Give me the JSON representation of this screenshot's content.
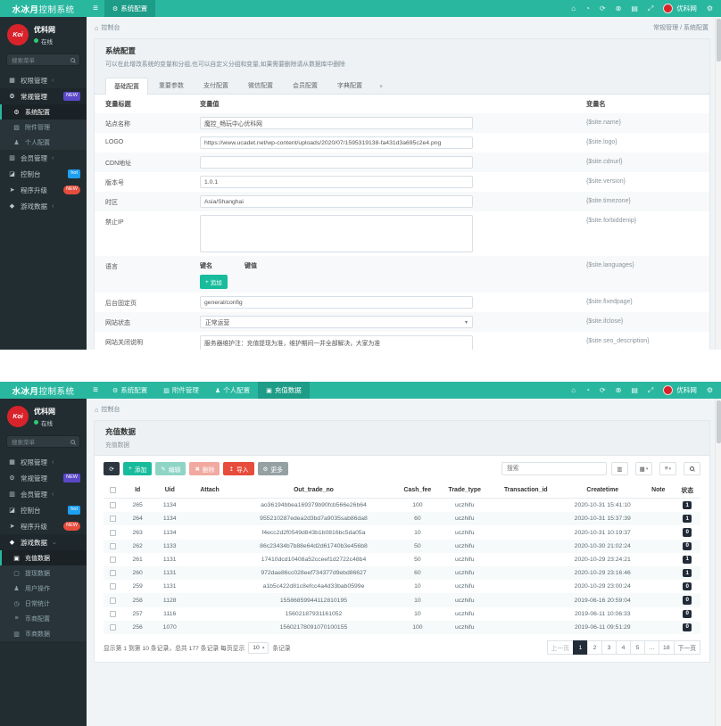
{
  "brand": {
    "bold": "水冰月",
    "rest": "控制系统"
  },
  "icons": {
    "burger": "≡",
    "gear": "⚙",
    "home": "⌂",
    "bell": "◔",
    "refresh": "⟳",
    "clear": "⊗",
    "layout": "▤",
    "fullscreen": "⤢",
    "add": "+",
    "edit": "✎",
    "delete": "✖",
    "import": "↥",
    "more": "⚙",
    "caret_down": "▾",
    "caret_up": "▴",
    "toggle_view": "▥",
    "columns": "▦",
    "export": "≡"
  },
  "user": {
    "logo_text": "Koi",
    "name": "优科网",
    "status": "在线"
  },
  "sidebar_search_placeholder": "搜索菜单",
  "top": {
    "navbar": {
      "tab": "系统配置"
    },
    "sidebar": [
      {
        "glyph": "▦",
        "label": "权限管理",
        "arrow": "‹",
        "cls": "item"
      },
      {
        "glyph": "⚙",
        "label": "常规管理",
        "badge": "NEW",
        "badgeClass": "b-new",
        "cls": "item open"
      },
      {
        "glyph": "⚙",
        "label": "系统配置",
        "cls": "sub active"
      },
      {
        "glyph": "▨",
        "label": "附件管理",
        "cls": "sub"
      },
      {
        "glyph": "♟",
        "label": "个人配置",
        "cls": "sub"
      },
      {
        "glyph": "▥",
        "label": "会员管理",
        "arrow": "‹",
        "cls": "item"
      },
      {
        "glyph": "◪",
        "label": "控制台",
        "badge": "hot",
        "badgeClass": "b-hot",
        "cls": "item"
      },
      {
        "glyph": "➤",
        "label": "程序升级",
        "badge": "NEW",
        "badgeClass": "b-red",
        "cls": "item"
      },
      {
        "glyph": "◆",
        "label": "游戏数据",
        "arrow": "‹",
        "cls": "item"
      }
    ],
    "breadcrumb": {
      "left": "控制台",
      "right": "常规管理 / 系统配置"
    },
    "panel": {
      "title": "系统配置",
      "desc": "可以在此增改系统的变量和分组,也可以自定义分组和变量,如果需要删除请从数据库中删除",
      "tabs": [
        {
          "label": "基础配置",
          "cls": "active"
        },
        {
          "label": "重要参数"
        },
        {
          "label": "支付配置"
        },
        {
          "label": "微信配置"
        },
        {
          "label": "会员配置"
        },
        {
          "label": "字典配置"
        },
        {
          "label": "+",
          "cls": "plus"
        }
      ]
    },
    "form": {
      "headers": [
        "变量标题",
        "变量值",
        "变量名"
      ],
      "kv_headers": [
        "键名",
        "键值"
      ],
      "append_label": "追加",
      "rows": [
        {
          "label": "站点名称",
          "value": "魔控_畅玩中心优科网",
          "var": "{$site.name}"
        },
        {
          "label": "LOGO",
          "value": "https://www.ucadet.net/wp-content/uploads/2020/07/1595319138-fa431d3a695c2e4.png",
          "var": "{$site.logo}"
        },
        {
          "label": "CDN地址",
          "value": "",
          "var": "{$site.cdnurl}"
        },
        {
          "label": "版本号",
          "value": "1.0.1",
          "var": "{$site.version}"
        },
        {
          "label": "时区",
          "value": "Asia/Shanghai",
          "var": "{$site.timezone}"
        },
        {
          "label": "禁止IP",
          "value": "",
          "var": "{$site.forbiddenip}"
        },
        {
          "label": "语言",
          "value": "",
          "var": "{$site.languages}"
        },
        {
          "label": "后台固定页",
          "value": "general/config",
          "var": "{$site.fixedpage}"
        },
        {
          "label": "网站状态",
          "value": "正常运营",
          "var": "{$site.ifclose}"
        },
        {
          "label": "网站关闭说明",
          "value": "服务器维护注：充值提现为准，维护期间一并全部解决，大家为准",
          "var": "{$site.seo_description}"
        }
      ]
    }
  },
  "bottom": {
    "navbar_tabs": [
      {
        "glyph": "⚙",
        "label": "系统配置",
        "cls": ""
      },
      {
        "glyph": "▨",
        "label": "附件管理",
        "cls": ""
      },
      {
        "glyph": "♟",
        "label": "个人配置",
        "cls": ""
      },
      {
        "glyph": "▣",
        "label": "充值数据",
        "cls": "active"
      }
    ],
    "sidebar": [
      {
        "glyph": "▦",
        "label": "权限管理",
        "arrow": "‹",
        "cls": "item"
      },
      {
        "glyph": "⚙",
        "label": "常规管理",
        "badge": "NEW",
        "badgeClass": "b-new",
        "cls": "item"
      },
      {
        "glyph": "▥",
        "label": "会员管理",
        "arrow": "‹",
        "cls": "item"
      },
      {
        "glyph": "◪",
        "label": "控制台",
        "badge": "hot",
        "badgeClass": "b-hot",
        "cls": "item"
      },
      {
        "glyph": "➤",
        "label": "程序升级",
        "badge": "NEW",
        "badgeClass": "b-red",
        "cls": "item"
      },
      {
        "glyph": "◆",
        "label": "游戏数据",
        "arrow": "⌄",
        "cls": "item open"
      },
      {
        "glyph": "▣",
        "label": "充值数据",
        "cls": "sub active"
      },
      {
        "glyph": "▢",
        "label": "提现数据",
        "cls": "sub"
      },
      {
        "glyph": "♟",
        "label": "用户操作",
        "cls": "sub"
      },
      {
        "glyph": "◷",
        "label": "日常统计",
        "cls": "sub"
      },
      {
        "glyph": "≡",
        "label": "币商配置",
        "cls": "sub"
      },
      {
        "glyph": "▥",
        "label": "币商数据",
        "cls": "sub"
      }
    ],
    "breadcrumb": {
      "left": "控制台"
    },
    "panel": {
      "title": "充值数据",
      "sub": "充值数据"
    },
    "toolbar": {
      "add": "添加",
      "edit": "编辑",
      "delete": "删除",
      "import": "导入",
      "more": "更多",
      "search_placeholder": "搜索"
    },
    "table": {
      "headers": [
        "Id",
        "Uid",
        "Attach",
        "Out_trade_no",
        "Cash_fee",
        "Trade_type",
        "Transaction_id",
        "Createtime",
        "Note",
        "状态"
      ],
      "rows": [
        {
          "id": "265",
          "uid": "1134",
          "attach": "",
          "out_trade_no": "ao36194bbea169379b90fcb566e26b64",
          "cash_fee": "100",
          "trade_type": "uczhifu",
          "transaction_id": "",
          "createtime": "2020-10-31 15:41:10",
          "note": "",
          "status": "1"
        },
        {
          "id": "264",
          "uid": "1134",
          "attach": "",
          "out_trade_no": "955210287edea2d3bd7a9035sab86da8",
          "cash_fee": "60",
          "trade_type": "uczhifu",
          "transaction_id": "",
          "createtime": "2020-10-31 15:37:39",
          "note": "",
          "status": "1"
        },
        {
          "id": "263",
          "uid": "1134",
          "attach": "",
          "out_trade_no": "f4ecc2d2f0549d843b1b0816bc5da05a",
          "cash_fee": "10",
          "trade_type": "uczhifu",
          "transaction_id": "",
          "createtime": "2020-10-31 10:19:37",
          "note": "",
          "status": "0"
        },
        {
          "id": "262",
          "uid": "1133",
          "attach": "",
          "out_trade_no": "86c23434b7b88e64d2d61740b3e456b8",
          "cash_fee": "50",
          "trade_type": "uczhifu",
          "transaction_id": "",
          "createtime": "2020-10-30 21:02:24",
          "note": "",
          "status": "0"
        },
        {
          "id": "261",
          "uid": "1131",
          "attach": "",
          "out_trade_no": "17410dcd10408a52cceef1d2722c48b4",
          "cash_fee": "50",
          "trade_type": "uczhifu",
          "transaction_id": "",
          "createtime": "2020-10-29 23:24:21",
          "note": "",
          "status": "1"
        },
        {
          "id": "260",
          "uid": "1131",
          "attach": "",
          "out_trade_no": "972dae86cc028eef734377d9ebd86627",
          "cash_fee": "60",
          "trade_type": "uczhifu",
          "transaction_id": "",
          "createtime": "2020-10-29 23:16:46",
          "note": "",
          "status": "1"
        },
        {
          "id": "259",
          "uid": "1131",
          "attach": "",
          "out_trade_no": "a1b5c422d81c8efcc4a4d33bab0599e",
          "cash_fee": "10",
          "trade_type": "uczhifu",
          "transaction_id": "",
          "createtime": "2020-10-29 23:00:24",
          "note": "",
          "status": "0"
        },
        {
          "id": "258",
          "uid": "1128",
          "attach": "",
          "out_trade_no": "15586859944112810195",
          "cash_fee": "10",
          "trade_type": "uczhifu",
          "transaction_id": "",
          "createtime": "2019-06-16 20:59:04",
          "note": "",
          "status": "0"
        },
        {
          "id": "257",
          "uid": "1116",
          "attach": "",
          "out_trade_no": "15602187931161052",
          "cash_fee": "10",
          "trade_type": "uczhifu",
          "transaction_id": "",
          "createtime": "2019-06-11 10:06:33",
          "note": "",
          "status": "0"
        },
        {
          "id": "256",
          "uid": "1070",
          "attach": "",
          "out_trade_no": "15602178091070100155",
          "cash_fee": "100",
          "trade_type": "uczhifu",
          "transaction_id": "",
          "createtime": "2019-06-11 09:51:29",
          "note": "",
          "status": "0"
        }
      ]
    },
    "footer": {
      "info_prefix": "显示第 1 到第 10 条记录，总共 177 条记录 每页显示",
      "per_page": "10",
      "info_suffix": "条记录",
      "pages": [
        {
          "label": "上一页",
          "cls": "disabled"
        },
        {
          "label": "1",
          "cls": "active"
        },
        {
          "label": "2"
        },
        {
          "label": "3"
        },
        {
          "label": "4"
        },
        {
          "label": "5"
        },
        {
          "label": "..."
        },
        {
          "label": "18"
        },
        {
          "label": "下一页"
        }
      ]
    }
  }
}
